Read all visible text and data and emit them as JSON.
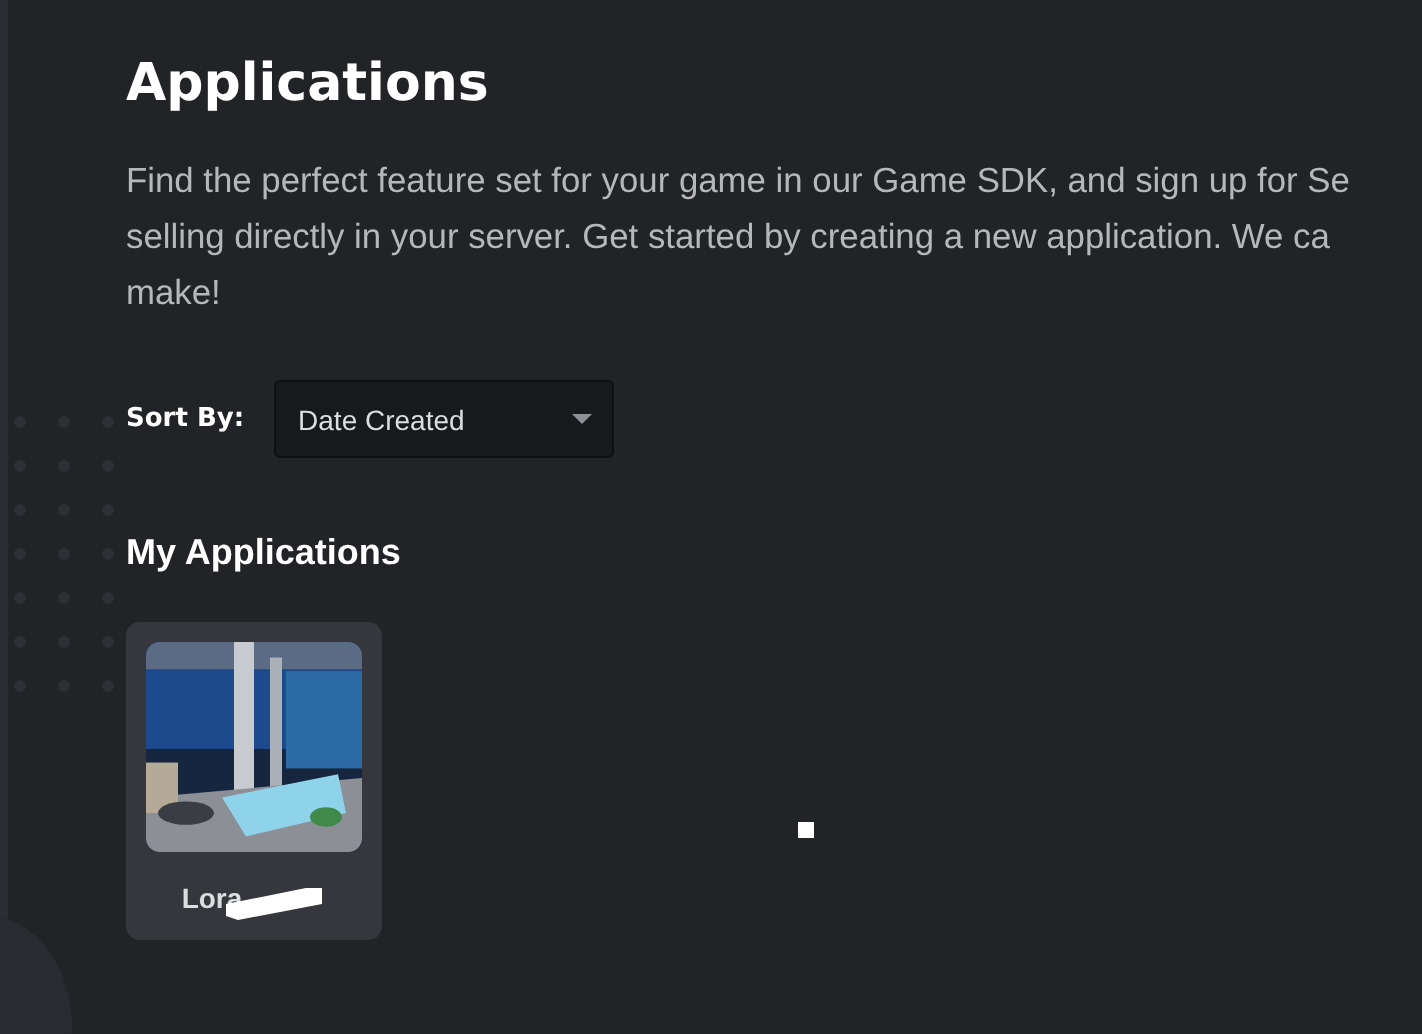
{
  "page": {
    "title": "Applications",
    "description_lines": [
      "Find the perfect feature set for your game in our Game SDK, and sign up for Se",
      "selling directly in your server. Get started by creating a new application. We ca",
      "make!"
    ]
  },
  "sort": {
    "label": "Sort By:",
    "value": "Date Created"
  },
  "section": {
    "title": "My Applications"
  },
  "applications": [
    {
      "name": "Lora",
      "redacted": true
    }
  ]
}
